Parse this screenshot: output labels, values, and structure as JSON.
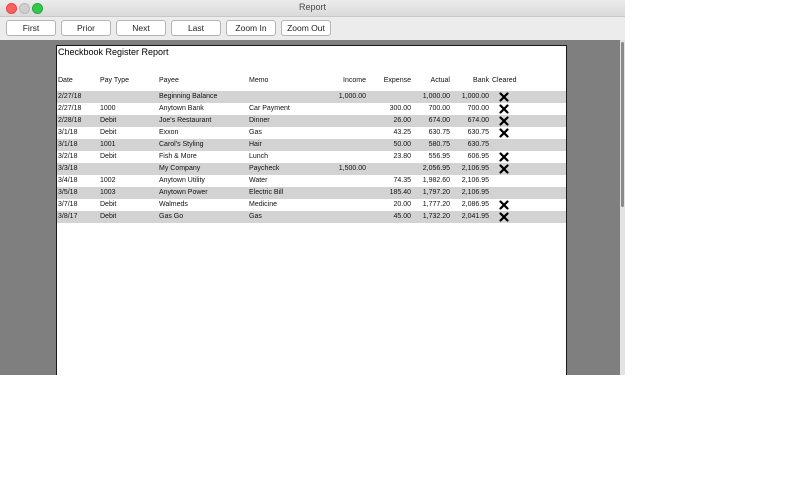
{
  "window": {
    "title": "Report"
  },
  "toolbar": {
    "buttons": [
      {
        "id": "first",
        "label": "First"
      },
      {
        "id": "prior",
        "label": "Prior"
      },
      {
        "id": "next",
        "label": "Next"
      },
      {
        "id": "last",
        "label": "Last"
      },
      {
        "id": "zoom-in",
        "label": "Zoom In"
      },
      {
        "id": "zoom-out",
        "label": "Zoom Out"
      }
    ]
  },
  "report": {
    "title": "Checkbook Register Report",
    "columns": [
      "Date",
      "Pay Type",
      "Payee",
      "Memo",
      "Income",
      "Expense",
      "Actual",
      "Bank",
      "Cleared"
    ],
    "rows": [
      {
        "date": "2/27/18",
        "paytype": "",
        "payee": "Beginning Balance",
        "memo": "",
        "income": "1,000.00",
        "expense": "",
        "actual": "1,000.00",
        "bank": "1,000.00",
        "cleared": true
      },
      {
        "date": "2/27/18",
        "paytype": "1000",
        "payee": "Anytown Bank",
        "memo": "Car Payment",
        "income": "",
        "expense": "300.00",
        "actual": "700.00",
        "bank": "700.00",
        "cleared": true
      },
      {
        "date": "2/28/18",
        "paytype": "Debit",
        "payee": "Joe's Restaurant",
        "memo": "Dinner",
        "income": "",
        "expense": "26.00",
        "actual": "674.00",
        "bank": "674.00",
        "cleared": true
      },
      {
        "date": "3/1/18",
        "paytype": "Debit",
        "payee": "Exxon",
        "memo": "Gas",
        "income": "",
        "expense": "43.25",
        "actual": "630.75",
        "bank": "630.75",
        "cleared": true
      },
      {
        "date": "3/1/18",
        "paytype": "1001",
        "payee": "Carol's Styling",
        "memo": "Hair",
        "income": "",
        "expense": "50.00",
        "actual": "580.75",
        "bank": "630.75",
        "cleared": false
      },
      {
        "date": "3/2/18",
        "paytype": "Debit",
        "payee": "Fish & More",
        "memo": "Lunch",
        "income": "",
        "expense": "23.80",
        "actual": "556.95",
        "bank": "606.95",
        "cleared": true
      },
      {
        "date": "3/3/18",
        "paytype": "",
        "payee": "My Company",
        "memo": "Paycheck",
        "income": "1,500.00",
        "expense": "",
        "actual": "2,056.95",
        "bank": "2,106.95",
        "cleared": true
      },
      {
        "date": "3/4/18",
        "paytype": "1002",
        "payee": "Anytown Utility",
        "memo": "Water",
        "income": "",
        "expense": "74.35",
        "actual": "1,982.60",
        "bank": "2,106.95",
        "cleared": false
      },
      {
        "date": "3/5/18",
        "paytype": "1003",
        "payee": "Anytown Power",
        "memo": "Electric Bill",
        "income": "",
        "expense": "185.40",
        "actual": "1,797.20",
        "bank": "2,106.95",
        "cleared": false
      },
      {
        "date": "3/7/18",
        "paytype": "Debit",
        "payee": "Walmeds",
        "memo": "Medicine",
        "income": "",
        "expense": "20.00",
        "actual": "1,777.20",
        "bank": "2,086.95",
        "cleared": true
      },
      {
        "date": "3/8/17",
        "paytype": "Debit",
        "payee": "Gas Go",
        "memo": "Gas",
        "income": "",
        "expense": "45.00",
        "actual": "1,732.20",
        "bank": "2,041.95",
        "cleared": true
      }
    ]
  },
  "icons": {
    "cleared": "x-mark-icon"
  },
  "colors": {
    "shaded_row": "#d3d3d3",
    "viewport_bg": "#7f7f7f",
    "close": "#fc605c",
    "maximize": "#34c84a"
  }
}
